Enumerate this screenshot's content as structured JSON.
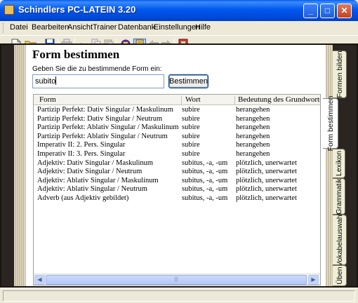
{
  "window": {
    "title": "Schindlers PC-LATEIN 3.20",
    "minimize": "_",
    "maximize": "□",
    "close": "✕"
  },
  "menu": [
    "Datei",
    "Bearbeiten",
    "Ansicht",
    "Trainer",
    "Datenbank",
    "Einstellungen",
    "Hilfe"
  ],
  "toolbar": {
    "icons": [
      "new-file-icon",
      "open-folder-icon",
      "save-icon",
      "print-icon",
      "cut-icon",
      "copy-icon",
      "paste-icon",
      "vocab-card-icon",
      "dictionary-icon",
      "back-arrow-icon",
      "forward-arrow-icon",
      "exit-icon"
    ]
  },
  "form": {
    "title": "Form bestimmen",
    "prompt": "Geben Sie die zu bestimmende Form ein:",
    "input_value": "subito",
    "button_label": "Bestimmen"
  },
  "table": {
    "columns": [
      "Form",
      "Wort",
      "Bedeutung des Grundworts"
    ],
    "rows": [
      [
        "Partizip Perfekt: Dativ Singular / Maskulinum",
        "subire",
        "herangehen"
      ],
      [
        "Partizip Perfekt: Dativ Singular / Neutrum",
        "subire",
        "herangehen"
      ],
      [
        "Partizip Perfekt: Ablativ Singular / Maskulinum",
        "subire",
        "herangehen"
      ],
      [
        "Partizip Perfekt: Ablativ Singular / Neutrum",
        "subire",
        "herangehen"
      ],
      [
        "Imperativ II: 2. Pers. Singular",
        "subire",
        "herangehen"
      ],
      [
        "Imperativ II: 3. Pers. Singular",
        "subire",
        "herangehen"
      ],
      [
        "Adjektiv: Dativ Singular / Maskulinum",
        "subitus, -a, -um",
        "plötzlich, unerwartet"
      ],
      [
        "Adjektiv: Dativ Singular / Neutrum",
        "subitus, -a, -um",
        "plötzlich, unerwartet"
      ],
      [
        "Adjektiv: Ablativ Singular / Maskulinum",
        "subitus, -a, -um",
        "plötzlich, unerwartet"
      ],
      [
        "Adjektiv: Ablativ Singular / Neutrum",
        "subitus, -a, -um",
        "plötzlich, unerwartet"
      ],
      [
        "Adverb (aus Adjektiv gebildet)",
        "subitus, -a, -um",
        "plötzlich, unerwartet"
      ]
    ]
  },
  "tabs": [
    "Formen bilden",
    "Form bestimmen",
    "Lexikon",
    "Grammatik",
    "Vokabelauswahl",
    "Üben"
  ],
  "active_tab": "Form bestimmen",
  "scrollbar": {
    "left_arrow": "◀",
    "right_arrow": "▶",
    "grip": "|||"
  }
}
